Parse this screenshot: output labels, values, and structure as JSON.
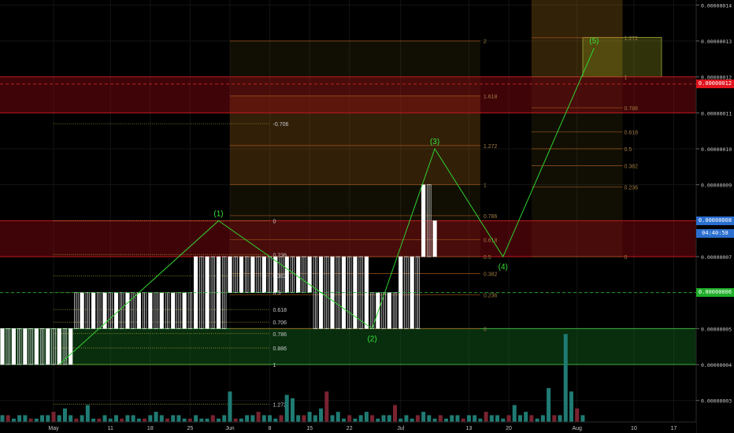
{
  "chart_data": {
    "type": "candlestick",
    "title": "",
    "ylim": [
      2.5e-09,
      1.45e-08
    ],
    "price_axis": {
      "ticks": [
        "0.00000014",
        "0.00000013",
        "0.00000012",
        "0.00000011",
        "0.00000010",
        "0.00000009",
        "0.00000008",
        "0.00000007",
        "0.00000006",
        "0.00000005",
        "0.00000004",
        "0.00000003"
      ],
      "tick_values": [
        14,
        13,
        12,
        11,
        10,
        9,
        8,
        7,
        6,
        5,
        4,
        3
      ]
    },
    "time_axis": {
      "labels": [
        "May",
        "11",
        "18",
        "25",
        "Jun",
        "8",
        "15",
        "22",
        "Jul",
        "13",
        "20",
        "Aug",
        "10",
        "17"
      ],
      "day_index": [
        0,
        10,
        17,
        24,
        31,
        38,
        45,
        52,
        61,
        73,
        80,
        92,
        102,
        109
      ]
    },
    "badges": [
      {
        "text": "0.00000012",
        "value": 11.8,
        "color": "#e0141e"
      },
      {
        "text": "0.00000008",
        "value": 8.0,
        "color": "#2a6ecf"
      },
      {
        "text": "04:40:58",
        "value": 7.65,
        "color": "#2a6ecf"
      },
      {
        "text": "0.00000006",
        "value": 6.0,
        "color": "#1fae2a"
      }
    ],
    "zones": [
      {
        "name": "resistance-zone-top",
        "from": 11.0,
        "to": 12.0,
        "color": "rgba(150,10,20,0.42)"
      },
      {
        "name": "resistance-zone-mid",
        "from": 7.0,
        "to": 8.0,
        "color": "rgba(150,10,20,0.42)"
      },
      {
        "name": "support-zone",
        "from": 4.0,
        "to": 5.0,
        "color": "rgba(20,110,30,0.42)"
      }
    ],
    "fib_left": {
      "levels": [
        {
          "label": "-0.706",
          "value": 10.7
        },
        {
          "label": "0",
          "value": 8.0
        },
        {
          "label": "0.236",
          "value": 7.06
        },
        {
          "label": "0.382",
          "value": 6.47
        },
        {
          "label": "0.5",
          "value": 6.0
        },
        {
          "label": "0.618",
          "value": 5.53
        },
        {
          "label": "0.706",
          "value": 5.18
        },
        {
          "label": "0.786",
          "value": 4.86
        },
        {
          "label": "0.886",
          "value": 4.46
        },
        {
          "label": "1",
          "value": 4.0
        },
        {
          "label": "1.272",
          "value": 2.9
        }
      ]
    },
    "fib_mid": {
      "levels": [
        {
          "label": "2",
          "value": 13.0
        },
        {
          "label": "1.618",
          "value": 11.47
        },
        {
          "label": "1.272",
          "value": 10.09
        },
        {
          "label": "1",
          "value": 9.0
        },
        {
          "label": "0.786",
          "value": 8.14
        },
        {
          "label": "0.618",
          "value": 7.47
        },
        {
          "label": "0.5",
          "value": 7.0
        },
        {
          "label": "0.382",
          "value": 6.53
        },
        {
          "label": "0.236",
          "value": 5.94
        },
        {
          "label": "0",
          "value": 5.0
        }
      ]
    },
    "fib_right": {
      "levels": [
        {
          "label": "1.272",
          "value": 13.09
        },
        {
          "label": "1",
          "value": 12.0
        },
        {
          "label": "0.786",
          "value": 11.14
        },
        {
          "label": "0.618",
          "value": 10.47
        },
        {
          "label": "0.5",
          "value": 10.0
        },
        {
          "label": "0.382",
          "value": 9.53
        },
        {
          "label": "0.236",
          "value": 8.94
        },
        {
          "label": "0",
          "value": 7.0
        }
      ]
    },
    "elliott_wave": [
      {
        "label": "",
        "day": 1,
        "value": 4.0
      },
      {
        "label": "(1)",
        "day": 29,
        "value": 8.0
      },
      {
        "label": "(2)",
        "day": 56,
        "value": 5.0
      },
      {
        "label": "(3)",
        "day": 67,
        "value": 10.0
      },
      {
        "label": "(4)",
        "day": 79,
        "value": 7.0
      },
      {
        "label": "(5)",
        "day": 95,
        "value": 12.8
      }
    ],
    "dashed_levels": [
      {
        "value": 11.8,
        "color": "#c62828"
      },
      {
        "value": 6.0,
        "color": "#1fae2a"
      }
    ],
    "volume": [
      2,
      2,
      1,
      2,
      2,
      1,
      1,
      2,
      2,
      3,
      2,
      4,
      2,
      1,
      2,
      5,
      1,
      1,
      2,
      1,
      2,
      1,
      2,
      2,
      1,
      1,
      2,
      3,
      2,
      1,
      2,
      2,
      1,
      1,
      2,
      1,
      1,
      2,
      1,
      2,
      9,
      1,
      1,
      2,
      2,
      3,
      2,
      2,
      1,
      2,
      8,
      7,
      2,
      2,
      3,
      2,
      4,
      9,
      2,
      3,
      1,
      2,
      1,
      2,
      3,
      2,
      1,
      2,
      2,
      5,
      1,
      2,
      1,
      2,
      3,
      2,
      1,
      2,
      1,
      2,
      2,
      1,
      2,
      2,
      1,
      3,
      2,
      2,
      1,
      2,
      5,
      2,
      3,
      2,
      1,
      2,
      10,
      2,
      2,
      26,
      9,
      4,
      2
    ]
  }
}
